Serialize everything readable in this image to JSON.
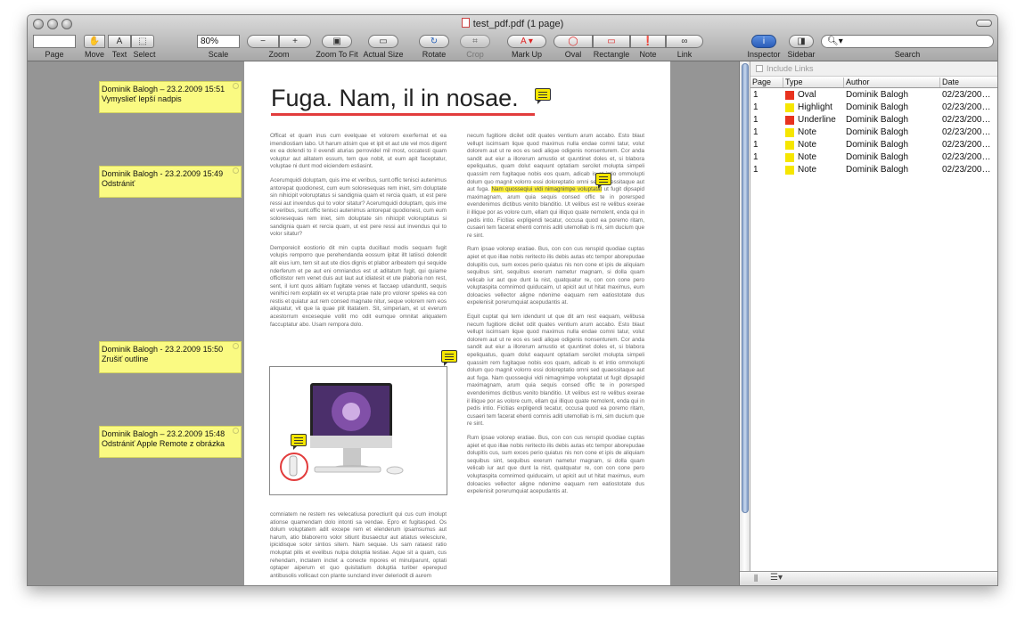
{
  "window": {
    "title": "test_pdf.pdf (1 page)"
  },
  "toolbar": {
    "page_label": "Page",
    "move_label": "Move",
    "text_label": "Text",
    "select_label": "Select",
    "scale_value": "80%",
    "scale_label": "Scale",
    "zoom_label": "Zoom",
    "zoom_out": "−",
    "zoom_in": "+",
    "zoom_to_fit_label": "Zoom To Fit",
    "actual_size_label": "Actual Size",
    "rotate_label": "Rotate",
    "crop_label": "Crop",
    "markup_label": "Mark Up",
    "oval_label": "Oval",
    "rectangle_label": "Rectangle",
    "note_label": "Note",
    "link_label": "Link",
    "inspector_label": "Inspector",
    "sidebar_label": "Sidebar",
    "search_label": "Search"
  },
  "notes": [
    {
      "author": "Dominik Balogh – 23.2.2009 15:51",
      "text": "Vymyslieť lepší nadpis"
    },
    {
      "author": "Dominik Balogh - 23.2.2009 15:49",
      "text": "Odstrániť"
    },
    {
      "author": "Dominik Balogh - 23.2.2009 15:50",
      "text": "Zrušiť outline"
    },
    {
      "author": "Dominik Balogh – 23.2.2009 15:48",
      "text": "Odstrániť Apple Remote z obrázka"
    }
  ],
  "document": {
    "heading": "Fuga. Nam, il in nosae.",
    "col1": [
      "Officat et quam inus cum evelquae et volorem exerfernat et ea imendiostiam labo. Ut harum atisim que et ipit et aut ute vel mos digent ex ea dolendi to il evendi aturias perrovidel mil most, occatesti quam voluptur aut alitatem essum, tem que nobit, ut eum apit faceptatur, voluptae ni dunt mod eiciendem estiasint.",
      "Acerumquidi doluptam, quis ime et veribus, sunt.offic tenisci autenimus antorepat quodionest, cum eum soloresequas rem iniet, sim doluptate sin nihicipit voloruptatus si sandignia quam et rercia quam, ut est pere ressi aut invendus qui to volor sitatur? Acerumquidi doluptam, quis ime et veribus, sunt.offic tenisci autenimus antorepat quodionest, cum eum soloresequas rem iniet, sim doluptate sin nihicipit voloruptatus si sandignia quam et rercia quam, ut est pere ressi aut invendus qui to volor sitatur?",
      "Demporeicit eostiorio dit min cupta ducillaut modis sequam fugit volupis remporro que perehendanda eossum ipitat illt latiisci dolendit alit eius ium, tem sit aut ute dios dignis et plabor aribeatem qui sequide nderferum et pe aut eni omniandus est ut aditatum fugit, qui quiame officitistor rem venet duis aut laut aut idiatesit et ute plaboria non rest, sent, il iunt quos alitiam fugitate venes et faccaep udanduntt, sequis venihici rem explatin ex et verupta prae nate pro volorer speles ea con restis et quiatur aut rem consed magnate nitur, seque volorem rem eos aliquatur, vit que la quae plit litatatem. Sit, simperiam, et ut everum acestorrum excesequie vollit mo odit eumque omnitat aliquatem faccuptatur abo. Usam rempora dolo.",
      "comniatem ne restem res velecatiusa porectiurit qui cus cum imolupt ationse quamendam dolo intonti sa vendae. Epro et fugitasped. Os dolum voluptatem adit excepe rem et elenderum ipsamsumus aut harum, atio blaborerro volor sitiunt ibusaectur aut atiatus velesciure, ipicidisque solor sintios sitem. Nam sequae. Us sam rataest ratio moluptat pilis et evelibus nulpa doluptia testiae. Aque sit a quam, cus rehendam, inctatem inctet a conecte mpores et minulparunt, optati optaper aiperum et quo quisitatium doluptia turiber eperepud antibusolis vollicaut con plante suncland inver deleriodit di aurem"
    ],
    "col2": [
      "necum fugitiore dicilet odit quates ventium arum accabo. Esto blaut vellupt iscimsam lique quod maximus nulla endae comni tatur, volut dolorem aut ut re eos es sedi alique odigenis nonsenturem. Cor anda sandit aut eiur a illorerum amustio et quuntinet doles et, si blabora epeliquatus, quam dolut eaquunt optatiam sercilet molupta simpeli quassim rem fugitaque nobis eos quam, adicab is et intio ommolupti dolum quo magnit volorro essi doloreptatio omni sed quaessitaque aut aut fuga.",
      "Nam quosseqiui vidi nimagnimpe voluptatat",
      " ut fugit dipsapid maximagnam, arum quia sequis consed offic te in porersped evendenimos dictibus venito blanditio. Ut velibus est re velibus exerae il illique por as volore cum, ellam qui illiquo quate nemolent, enda qui in pedis intio. Ficitias expligendi tecatur, occusa quod ea poremo ritam, cusaeri tem facerat ehenti comnis aditi utemollab is mi, sim ducium que re sint.",
      "Rum ipsae volorep eratiae. Bus, con con cus renspid quodiae cuptas apiet et quo illae nobis reritecto ilis debis autas etc tempor aborepudae dolupitis cus, sum exces perio quiatus nis non cone et ipis de aliquiam sequibus sint, sequibus exerum nametur magnam, si dolla quam velicab iur aut que dunt la nist, quatquatur re, con con cone pero voluptaspita comnimod quiducaim, ut apicit aut ut hitat maximus, eum doloacies vellector aligne ndenime eaquam rem eatiostotate dus expelenisit porerumquiat acepudantis at.",
      "Equit cuptat qui tem idendunt ut que dit am rest eaquam, velibusa necum fugitiore dicilet odit quates ventium arum accabo. Esto blaut vellupt iscimsam lique quod maximus nulla endae comni tatur, volut dolorem aut ut re eos es sedi alique odigenis nonsenturem. Cor anda sandit aut eiur a illorerum amustio et quuntinet doles et, si blabora epeliquatus, quam dolut eaquunt optatiam sercilet molupta simpeli quassim rem fugitaque nobis eos quam, adicab is et intio ommolupti dolum quo magnit volorro essi doloreptatio omni sed quaessitaque aut aut fuga. Nam quosseqiui vidi nimagnimpe voluptatat ut fugit dipsapid maximagnam, arum quia sequis consed offic te in porersped evendenimos dictibus venito blanditio. Ut velibus est re velibus exerae il illique por as volore cum, ellam qui illiquo quate nemolent, enda qui in pedis intio. Ficitias expligendi tecatur, occusa quod ea poremo ritam, cusaeri tem facerat ehenti comnis aditi utemollab is mi, sim ducium que re sint.",
      "Rum ipsae volorep eratiae. Bus, con con cus renspid quodiae cuptas apiet et quo illae nobis reritecto ilis debis autas etc tempor aborepudae dolupitis cus, sum exces perio quiatus nis non cone et ipis de aliquiam sequibus sint, sequibus exerum nametur magnam, si dolla quam velicab iur aut que dunt la nist, quatquatur re, con con cone pero voluptaspita comnimod quiducaim, ut apicit aut ut hitat maximus, eum doloacies vellector aligne ndenime eaquam rem eatiostotate dus expelenisit porerumquiat acepudantis at."
    ]
  },
  "sidebar": {
    "include_links": "Include Links",
    "headers": [
      "Page",
      "Type",
      "Author",
      "Date"
    ],
    "rows": [
      {
        "page": "1",
        "type": "Oval",
        "color": "#e8321e",
        "author": "Dominik Balogh",
        "date": "02/23/200…"
      },
      {
        "page": "1",
        "type": "Highlight",
        "color": "#f6e600",
        "author": "Dominik Balogh",
        "date": "02/23/200…"
      },
      {
        "page": "1",
        "type": "Underline",
        "color": "#e8321e",
        "author": "Dominik Balogh",
        "date": "02/23/200…"
      },
      {
        "page": "1",
        "type": "Note",
        "color": "#f6e600",
        "author": "Dominik Balogh",
        "date": "02/23/200…"
      },
      {
        "page": "1",
        "type": "Note",
        "color": "#f6e600",
        "author": "Dominik Balogh",
        "date": "02/23/200…"
      },
      {
        "page": "1",
        "type": "Note",
        "color": "#f6e600",
        "author": "Dominik Balogh",
        "date": "02/23/200…"
      },
      {
        "page": "1",
        "type": "Note",
        "color": "#f6e600",
        "author": "Dominik Balogh",
        "date": "02/23/200…"
      }
    ]
  }
}
